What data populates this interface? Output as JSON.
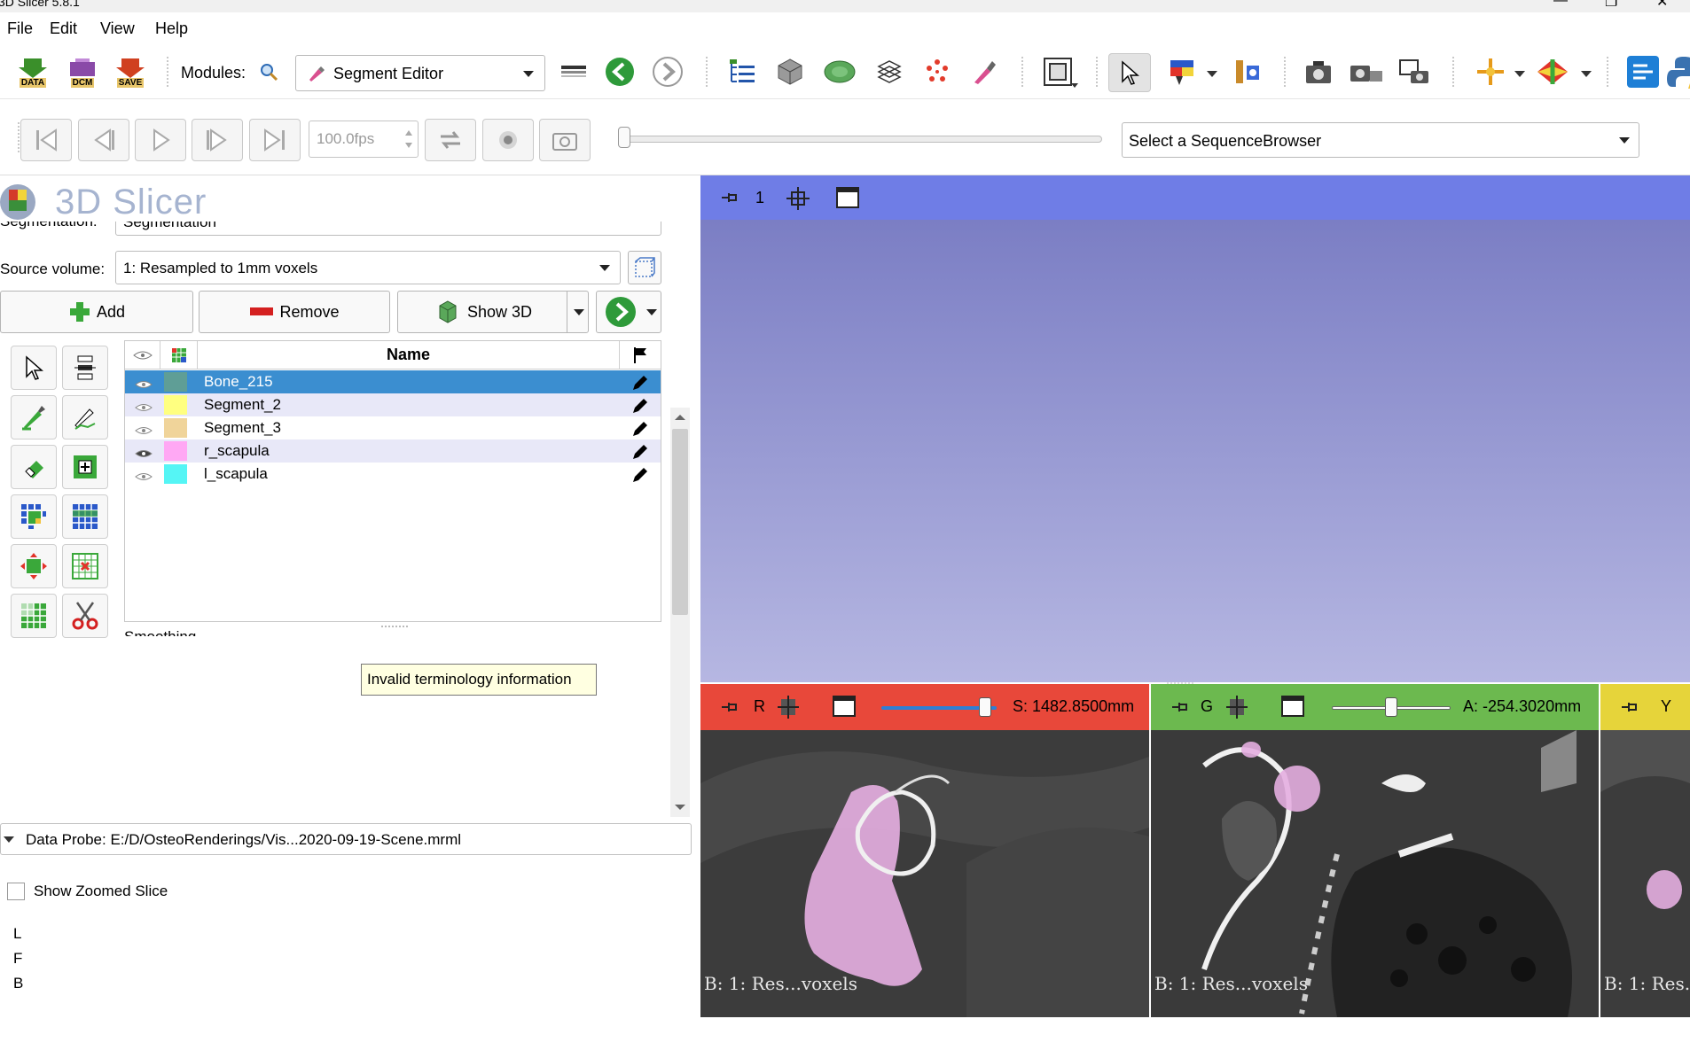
{
  "window": {
    "title": "3D Slicer 5.8.1"
  },
  "menu": [
    "File",
    "Edit",
    "View",
    "Help"
  ],
  "toolbar": {
    "data_label": "DATA",
    "dcm_label": "DCM",
    "save_label": "SAVE",
    "modules_label": "Modules:",
    "module_selected": "Segment Editor"
  },
  "sequence": {
    "fps": "100.0fps",
    "browser_placeholder": "Select a SequenceBrowser"
  },
  "module_panel": {
    "logo_text": "3D Slicer",
    "segmentation_label": "Segmentation:",
    "segmentation_value": "Segmentation",
    "source_volume_label": "Source volume:",
    "source_volume_value": "1: Resampled to 1mm voxels",
    "add_label": "Add",
    "remove_label": "Remove",
    "show3d_label": "Show 3D",
    "table_header_name": "Name",
    "segments": [
      {
        "name": "Bone_215",
        "color": "#5f9e96",
        "selected": true
      },
      {
        "name": "Segment_2",
        "color": "#ffff80",
        "selected": false
      },
      {
        "name": "Segment_3",
        "color": "#f0d49a",
        "selected": false
      },
      {
        "name": "r_scapula",
        "color": "#ffa8f4",
        "selected": false
      },
      {
        "name": "l_scapula",
        "color": "#55f5f5",
        "selected": false
      }
    ],
    "tooltip": "Invalid terminology information",
    "smoothing_label": "Smoothing"
  },
  "data_probe": {
    "label": "Data Probe: E:/D/OsteoRenderings/Vis...2020-09-19-Scene.mrml",
    "show_zoomed_slice": "Show Zoomed Slice",
    "coords": [
      "L",
      "F",
      "B"
    ]
  },
  "views": {
    "view3d": {
      "number": "1"
    },
    "red": {
      "letter": "R",
      "offset": "S: 1482.8500mm",
      "info": "B: 1: Res...voxels",
      "color": "#e8483a",
      "slider_level": 0.9
    },
    "green": {
      "letter": "G",
      "offset": "A: -254.3020mm",
      "info": "B: 1: Res...voxels",
      "color": "#6cb94f",
      "slider_level": 0.5
    },
    "yellow": {
      "letter": "Y",
      "info": "B: 1: Res...",
      "color": "#e6d43a"
    }
  }
}
